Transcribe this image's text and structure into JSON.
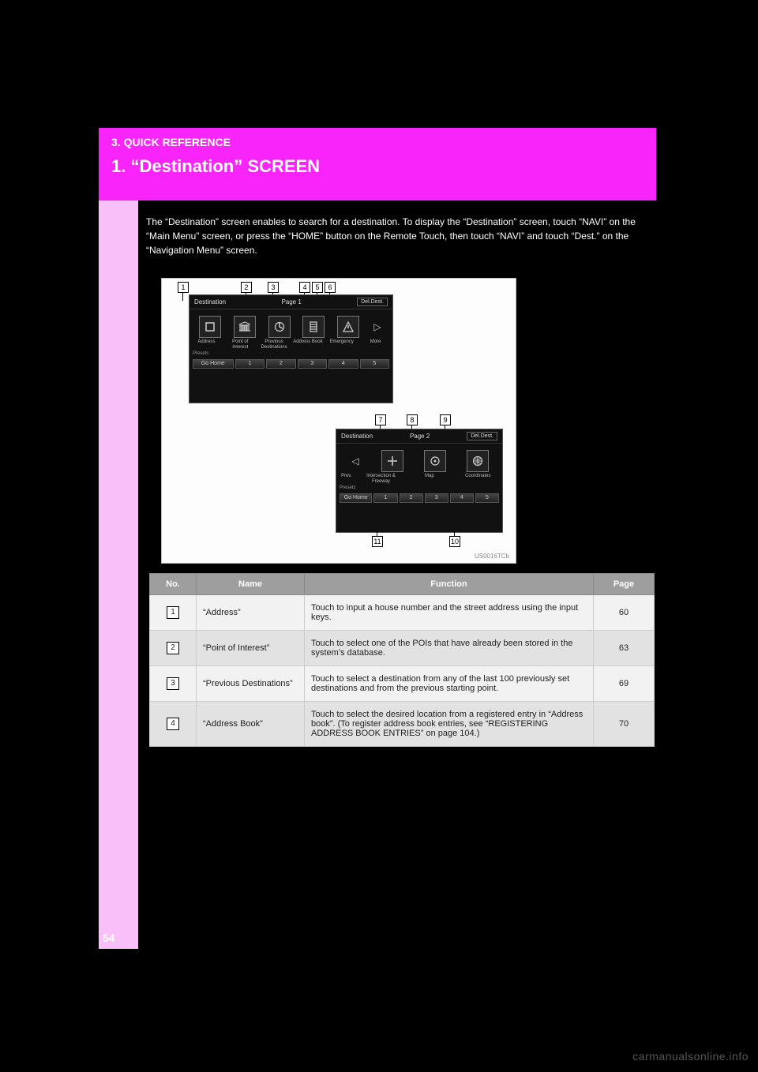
{
  "header": {
    "kicker": "3. QUICK REFERENCE",
    "title": "1. “Destination” SCREEN"
  },
  "intro": "The “Destination” screen enables to search for a destination. To display the “Destination” screen, touch “NAVI” on the “Main Menu” screen, or press the “HOME” button on the Remote Touch, then touch “NAVI” and touch “Dest.” on the “Navigation Menu” screen.",
  "figure": {
    "id_label": "US0016TCb",
    "callouts": [
      "1",
      "2",
      "3",
      "4",
      "5",
      "6",
      "7",
      "8",
      "9",
      "10",
      "11"
    ],
    "screen1": {
      "title": "Destination",
      "page_label": "Page 1",
      "delete_button": "Del.Dest.",
      "items": [
        "Address",
        "Point of Interest",
        "Previous Destinations",
        "Address Book",
        "Emergency",
        "More"
      ],
      "presets_label": "Presets",
      "go_home": "Go Home",
      "preset_slots": [
        "1",
        "2",
        "3",
        "4",
        "5"
      ]
    },
    "screen2": {
      "title": "Destination",
      "page_label": "Page 2",
      "delete_button": "Del.Dest.",
      "items": [
        "Prev.",
        "Intersection & Freeway",
        "Map",
        "Coordinates"
      ],
      "presets_label": "Presets",
      "go_home": "Go Home",
      "preset_slots": [
        "1",
        "2",
        "3",
        "4",
        "5"
      ]
    }
  },
  "table": {
    "headers": {
      "no": "No.",
      "name": "Name",
      "function": "Function",
      "page": "Page"
    },
    "rows": [
      {
        "no": "1",
        "name": "“Address”",
        "function": "Touch to input a house number and the street address using the input keys.",
        "page": "60"
      },
      {
        "no": "2",
        "name": "“Point of Interest”",
        "function": "Touch to select one of the POIs that have already been stored in the system’s database.",
        "page": "63"
      },
      {
        "no": "3",
        "name": "“Previous Destinations”",
        "function": "Touch to select a destination from any of the last 100 previously set destinations and from the previous starting point.",
        "page": "69"
      },
      {
        "no": "4",
        "name": "“Address Book”",
        "function": "Touch to select the desired location from a registered entry in “Address book”. (To register address book entries, see “REGISTERING ADDRESS BOOK ENTRIES” on page 104.)",
        "page": "70"
      }
    ]
  },
  "page_number": "54",
  "watermark": "carmanualsonline.info"
}
